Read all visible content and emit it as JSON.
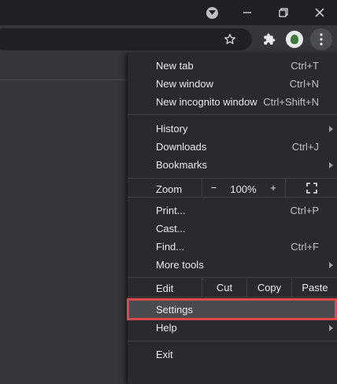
{
  "colors": {
    "highlight": "#e0484c",
    "menu_bg": "#292a2d",
    "toolbar_bg": "#35363a",
    "titlebar_bg": "#202124"
  },
  "icons": {
    "tab_search": "chevron-down-icon",
    "minimize": "minimize-icon",
    "maximize": "restore-icon",
    "close": "close-icon",
    "bookmark": "star-icon",
    "extensions": "puzzle-piece-icon",
    "profile": "avatar-icon",
    "menu": "kebab-menu-icon",
    "fullscreen": "fullscreen-icon"
  },
  "menu": {
    "new_tab": {
      "label": "New tab",
      "shortcut": "Ctrl+T"
    },
    "new_window": {
      "label": "New window",
      "shortcut": "Ctrl+N"
    },
    "new_incognito": {
      "label": "New incognito window",
      "shortcut": "Ctrl+Shift+N"
    },
    "history": {
      "label": "History"
    },
    "downloads": {
      "label": "Downloads",
      "shortcut": "Ctrl+J"
    },
    "bookmarks": {
      "label": "Bookmarks"
    },
    "zoom": {
      "label": "Zoom",
      "minus": "−",
      "value": "100%",
      "plus": "+"
    },
    "print": {
      "label": "Print...",
      "shortcut": "Ctrl+P"
    },
    "cast": {
      "label": "Cast..."
    },
    "find": {
      "label": "Find...",
      "shortcut": "Ctrl+F"
    },
    "more_tools": {
      "label": "More tools"
    },
    "edit": {
      "label": "Edit",
      "cut": "Cut",
      "copy": "Copy",
      "paste": "Paste"
    },
    "settings": {
      "label": "Settings"
    },
    "help": {
      "label": "Help"
    },
    "exit": {
      "label": "Exit"
    }
  }
}
